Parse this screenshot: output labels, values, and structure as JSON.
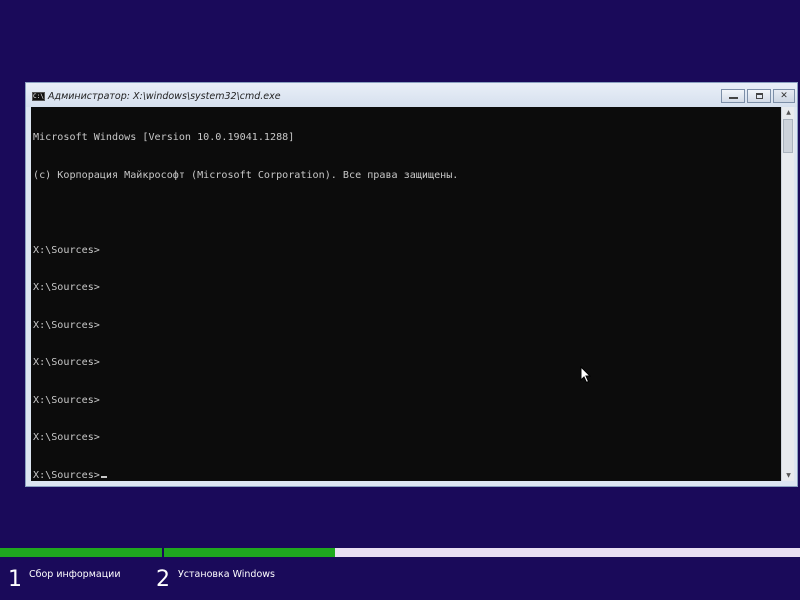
{
  "window": {
    "title": "Администратор: X:\\windows\\system32\\cmd.exe",
    "icon": "cmd-icon",
    "buttons": [
      "minimize-icon",
      "maximize-icon",
      "close-icon"
    ]
  },
  "console": {
    "lines": [
      "Microsoft Windows [Version 10.0.19041.1288]",
      "(c) Корпорация Майкрософт (Microsoft Corporation). Все права защищены.",
      "",
      "X:\\Sources>",
      "X:\\Sources>",
      "X:\\Sources>",
      "X:\\Sources>",
      "X:\\Sources>",
      "X:\\Sources>",
      "X:\\Sources>"
    ],
    "text_color": "#c8c8c8",
    "background": "#0c0c0c"
  },
  "setup": {
    "progress_color": "#1fa81f",
    "steps": [
      {
        "number": "1",
        "label": "Сбор информации"
      },
      {
        "number": "2",
        "label": "Установка Windows"
      }
    ]
  },
  "colors": {
    "desktop": "#1a0a5a"
  }
}
